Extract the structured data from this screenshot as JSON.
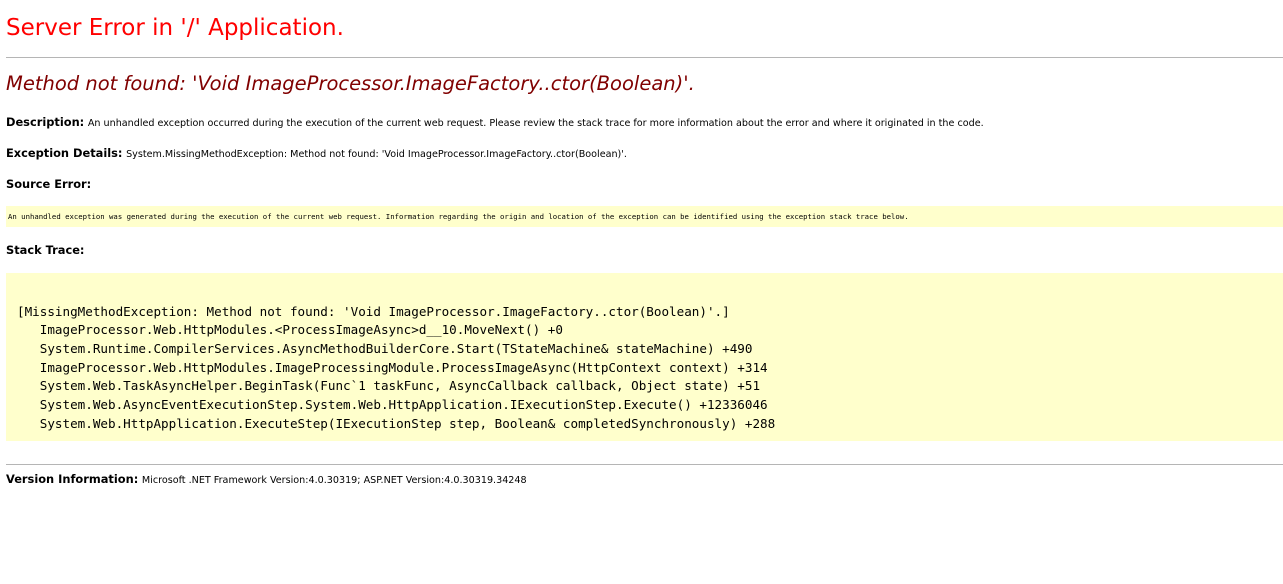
{
  "page": {
    "title": "Server Error in '/' Application.",
    "error_message": "Method not found: 'Void ImageProcessor.ImageFactory..ctor(Boolean)'."
  },
  "description": {
    "label": "Description:",
    "text": "An unhandled exception occurred during the execution of the current web request. Please review the stack trace for more information about the error and where it originated in the code."
  },
  "exception_details": {
    "label": "Exception Details:",
    "text": "System.MissingMethodException: Method not found: 'Void ImageProcessor.ImageFactory..ctor(Boolean)'."
  },
  "source_error": {
    "label": "Source Error:",
    "text": "An unhandled exception was generated during the execution of the current web request. Information regarding the origin and location of the exception can be identified using the exception stack trace below."
  },
  "stack_trace": {
    "label": "Stack Trace:",
    "lines": [
      "[MissingMethodException: Method not found: 'Void ImageProcessor.ImageFactory..ctor(Boolean)'.]",
      "   ImageProcessor.Web.HttpModules.<ProcessImageAsync>d__10.MoveNext() +0",
      "   System.Runtime.CompilerServices.AsyncMethodBuilderCore.Start(TStateMachine& stateMachine) +490",
      "   ImageProcessor.Web.HttpModules.ImageProcessingModule.ProcessImageAsync(HttpContext context) +314",
      "   System.Web.TaskAsyncHelper.BeginTask(Func`1 taskFunc, AsyncCallback callback, Object state) +51",
      "   System.Web.AsyncEventExecutionStep.System.Web.HttpApplication.IExecutionStep.Execute() +12336046",
      "   System.Web.HttpApplication.ExecuteStep(IExecutionStep step, Boolean& completedSynchronously) +288"
    ]
  },
  "version_info": {
    "label": "Version Information:",
    "text": "Microsoft .NET Framework Version:4.0.30319; ASP.NET Version:4.0.30319.34248"
  },
  "colors": {
    "title": "#ff0000",
    "error_message": "#800000",
    "code_background": "#ffffcc",
    "rule": "#b5b5b5"
  }
}
